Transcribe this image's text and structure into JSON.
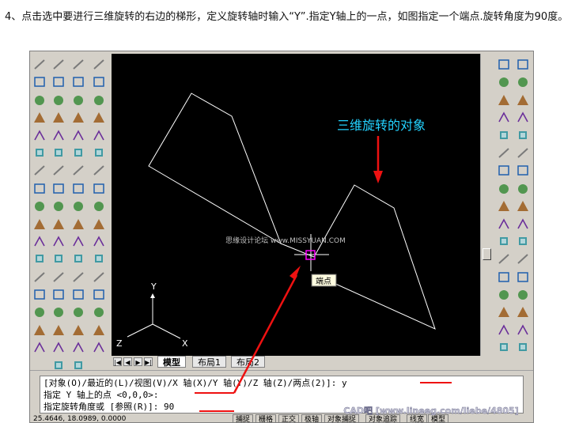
{
  "instruction": "4、点击选中要进行三维旋转的右边的梯形，定义旋转轴时输入“Y”.指定Y轴上的一点，如图指定一个端点.旋转角度为90度。",
  "annotation": "三维旋转的对象",
  "osnap_tooltip": "端点",
  "watermark_center": "思缘设计论坛 www.MISSYUAN.COM",
  "watermark_bottom": "CAD吧 [www.lineeg.com/liebe/4805]",
  "ucs": {
    "x": "X",
    "y": "Y",
    "z": "Z"
  },
  "tabs": [
    "模型",
    "布局1",
    "布局2"
  ],
  "nav_buttons": [
    "|◀",
    "◀",
    "▶",
    "▶|"
  ],
  "command_lines": [
    "[对象(O)/最近的(L)/视图(V)/X 轴(X)/Y 轴(Y)/Z 轴(Z)/两点(2)]: y",
    "指定 Y 轴上的点 <0,0,0>:",
    "指定旋转角度或 [参照(R)]: 90"
  ],
  "status": {
    "coords": "25.4646, 18.0989, 0.0000",
    "buttons": [
      "捕捉",
      "栅格",
      "正交",
      "极轴",
      "对象捕捉",
      "对象追踪",
      "线宽",
      "模型"
    ]
  },
  "toolbars": {
    "left1": [
      "ucs-icon",
      "ucs-world-icon",
      "ucs-previous-icon",
      "ucs-object-icon",
      "ucs-face-icon",
      "ucs-view-icon",
      "ucs-origin-icon",
      "ucs-zaxis-icon",
      "ucs-3point-icon",
      "ucs-x-icon",
      "ucs-y-icon",
      "ucs-z-icon",
      "view-iso-icon",
      "camera-icon",
      "top-view-icon",
      "front-view-icon",
      "right-view-icon"
    ],
    "left2": [
      "box-icon",
      "wedge-icon",
      "pyramid-icon",
      "sphere-icon",
      "cylinder-icon",
      "cone-icon",
      "torus-icon",
      "extrude-icon",
      "revolve-icon",
      "slice-icon",
      "section-icon",
      "interfere-icon",
      "setup-icon",
      "render-icon",
      "material-icon",
      "light-icon",
      "scene-icon",
      "fog-icon"
    ],
    "left3": [
      "union-icon",
      "subtract-icon",
      "intersect-icon",
      "extrude-face-icon",
      "move-face-icon",
      "offset-face-icon",
      "delete-face-icon",
      "rotate-face-icon",
      "taper-face-icon",
      "copy-face-icon",
      "color-face-icon",
      "imprint-icon",
      "clean-icon",
      "separate-icon",
      "shell-icon",
      "check-icon",
      "flatshot-icon",
      "paint-icon"
    ],
    "left4": [
      "cube-icon",
      "sphere-shade-icon",
      "cylinder-shade-icon",
      "cone-shade-icon",
      "wedge-shade-icon",
      "torus-shade-icon",
      "orbit-icon",
      "pan-icon",
      "zoom-icon",
      "hide-icon",
      "shade-icon",
      "gouraud-icon",
      "wireframe-icon",
      "flat-icon",
      "xray-icon",
      "realistic-icon",
      "conceptual-icon"
    ],
    "right1": [
      "line-icon",
      "construction-line-icon",
      "polyline-icon",
      "polygon-icon",
      "rectangle-icon",
      "arc-icon",
      "circle-icon",
      "revcloud-icon",
      "spline-icon",
      "ellipse-icon",
      "ellipse-arc-icon",
      "insert-block-icon",
      "make-block-icon",
      "point-icon",
      "hatch-icon",
      "region-icon",
      "text-icon"
    ],
    "right2": [
      "erase-icon",
      "copy-icon",
      "mirror-icon",
      "offset-icon",
      "array-icon",
      "move-icon",
      "rotate-icon",
      "scale-icon",
      "stretch-icon",
      "trim-icon",
      "extend-icon",
      "break-at-point-icon",
      "break-icon",
      "join-icon",
      "chamfer-icon",
      "fillet-icon",
      "explode-icon"
    ]
  }
}
